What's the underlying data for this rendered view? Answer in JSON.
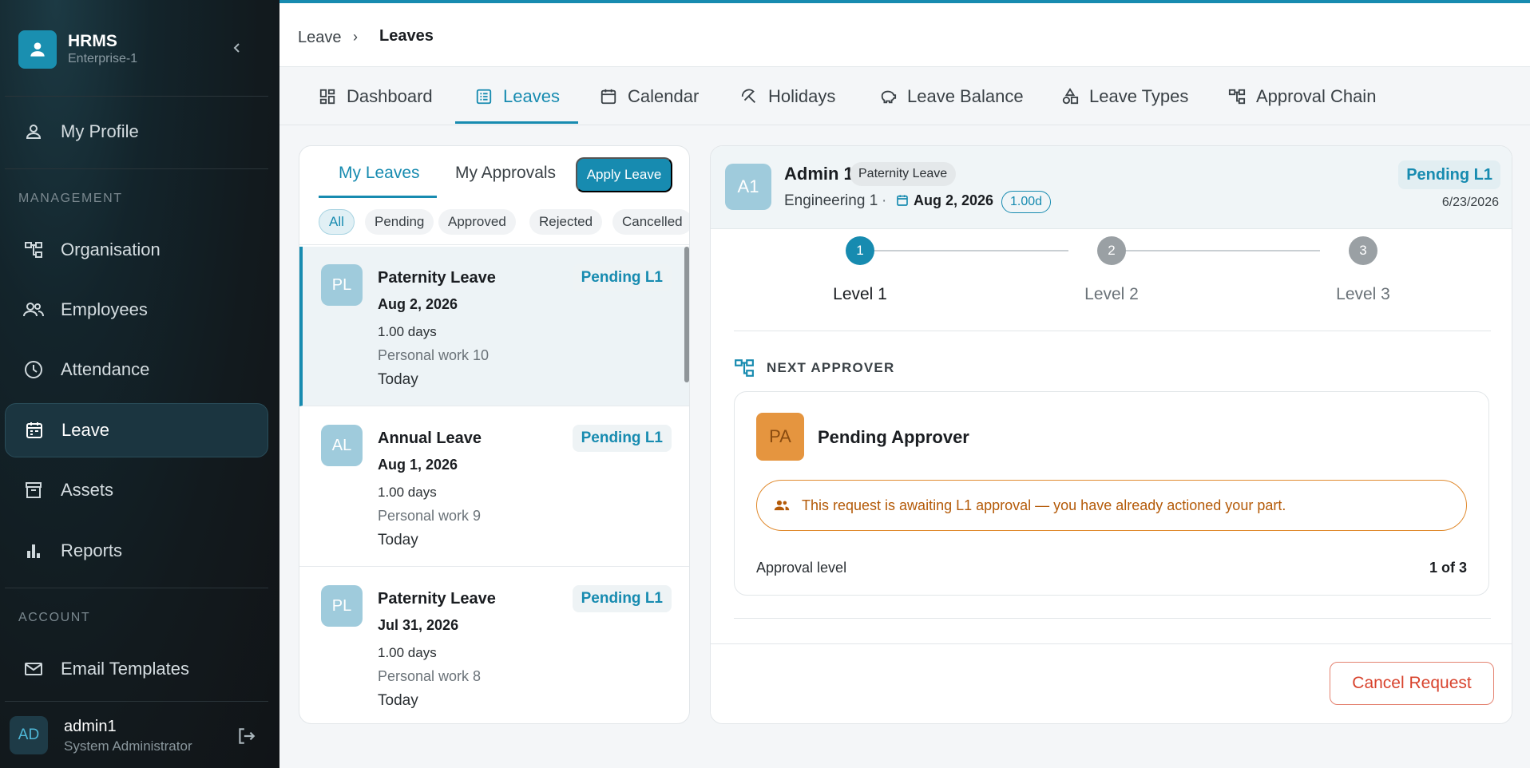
{
  "app": {
    "name": "HRMS",
    "subtitle": "Enterprise-1",
    "logo_icon": "user-icon",
    "accent": "#178bb0"
  },
  "sidebar": {
    "top_item": {
      "label": "My Profile",
      "icon": "person-icon"
    },
    "management_title": "MANAGEMENT",
    "management": [
      {
        "label": "Organisation",
        "icon": "org-chart-icon"
      },
      {
        "label": "Employees",
        "icon": "people-icon"
      },
      {
        "label": "Attendance",
        "icon": "clock-icon"
      },
      {
        "label": "Leave",
        "icon": "calendar-icon",
        "active": true
      },
      {
        "label": "Assets",
        "icon": "archive-icon"
      },
      {
        "label": "Reports",
        "icon": "bar-chart-icon"
      }
    ],
    "account_title": "ACCOUNT",
    "account": [
      {
        "label": "Email Templates",
        "icon": "mail-icon"
      }
    ],
    "user": {
      "initials": "AD",
      "name": "admin1",
      "role": "System Administrator"
    }
  },
  "breadcrumb": {
    "parent": "Leave",
    "separator": "›",
    "current": "Leaves"
  },
  "tabs": [
    {
      "label": "Dashboard",
      "icon": "dashboard-icon"
    },
    {
      "label": "Leaves",
      "icon": "list-icon",
      "active": true
    },
    {
      "label": "Calendar",
      "icon": "calendar-icon"
    },
    {
      "label": "Holidays",
      "icon": "umbrella-icon"
    },
    {
      "label": "Leave Balance",
      "icon": "piggy-bank-icon"
    },
    {
      "label": "Leave Types",
      "icon": "shapes-icon"
    },
    {
      "label": "Approval Chain",
      "icon": "hierarchy-icon"
    }
  ],
  "list_panel": {
    "tabs": [
      {
        "label": "My Leaves",
        "active": true
      },
      {
        "label": "My Approvals"
      }
    ],
    "apply_button": "Apply Leave",
    "filters": [
      {
        "label": "All",
        "active": true
      },
      {
        "label": "Pending"
      },
      {
        "label": "Approved"
      },
      {
        "label": "Rejected"
      },
      {
        "label": "Cancelled"
      }
    ],
    "items": [
      {
        "initials": "PL",
        "title": "Paternity Leave",
        "date": "Aug 2, 2026",
        "days": "1.00 days",
        "reason": "Personal work 10",
        "when": "Today",
        "status": "Pending L1",
        "selected": true
      },
      {
        "initials": "AL",
        "title": "Annual Leave",
        "date": "Aug 1, 2026",
        "days": "1.00 days",
        "reason": "Personal work 9",
        "when": "Today",
        "status": "Pending L1"
      },
      {
        "initials": "PL",
        "title": "Paternity Leave",
        "date": "Jul 31, 2026",
        "days": "1.00 days",
        "reason": "Personal work 8",
        "when": "Today",
        "status": "Pending L1"
      }
    ]
  },
  "detail": {
    "initials": "A1",
    "name": "Admin 1",
    "leave_type": "Paternity Leave",
    "department": "Engineering 1",
    "dot": "·",
    "date": "Aug 2, 2026",
    "days": "1.00d",
    "status": "Pending L1",
    "requested_on": "6/23/2026",
    "steps": [
      {
        "number": "1",
        "label": "Level 1",
        "done": true
      },
      {
        "number": "2",
        "label": "Level 2"
      },
      {
        "number": "3",
        "label": "Level 3"
      }
    ],
    "next_approver_title": "NEXT APPROVER",
    "approver": {
      "initials": "PA",
      "name": "Pending Approver",
      "alert": "This request is awaiting L1 approval — you have already actioned your part.",
      "level_label": "Approval level",
      "level_value": "1 of 3"
    },
    "cancel_button": "Cancel Request"
  }
}
